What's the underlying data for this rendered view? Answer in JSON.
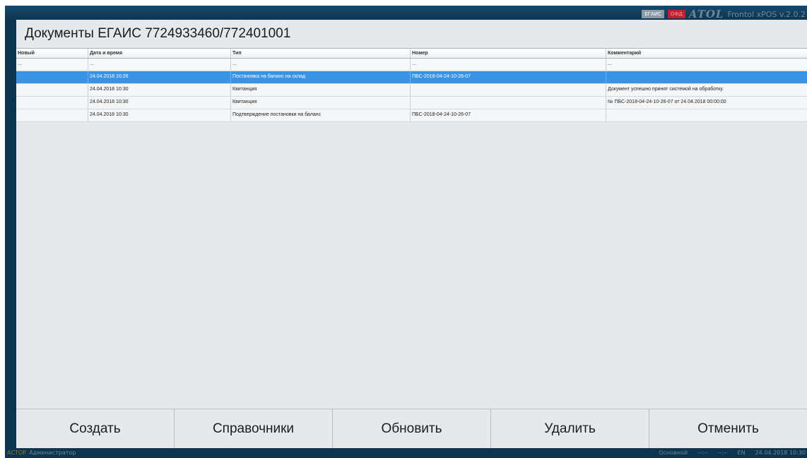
{
  "topbar": {
    "badges": [
      "ЕГАИС",
      "ОФД"
    ],
    "logo": "ATOL",
    "version": "Frontol xPOS v.2.0.2"
  },
  "window": {
    "title": "Документы ЕГАИС 7724933460/772401001"
  },
  "grid": {
    "columns": [
      "Новый",
      "Дата и время",
      "Тип",
      "Номер",
      "Комментарий"
    ],
    "filter_row": [
      "...",
      "...",
      "...",
      "...",
      "..."
    ],
    "rows": [
      [
        "",
        "24.04.2018 10:26",
        "Постановка на баланс на склад",
        "ПБС-2018-04-24-10-26-07",
        ""
      ],
      [
        "",
        "24.04.2018 10:30",
        "Квитанция",
        "",
        "Документ успешно принят системой на обработку."
      ],
      [
        "",
        "24.04.2018 10:30",
        "Квитанция",
        "",
        "№ ПБС-2018-04-24-10-26-07 от 24.04.2018 00:00:00"
      ],
      [
        "",
        "24.04.2018 10:30",
        "Подтверждение постановки на баланс",
        "ПБС-2018-04-24-10-26-07",
        ""
      ]
    ],
    "selected_row": 0
  },
  "actions": {
    "create": "Создать",
    "references": "Справочники",
    "refresh": "Обновить",
    "delete": "Удалить",
    "cancel": "Отменить"
  },
  "statusbar": {
    "app": "АСТОР",
    "user": "Администратор",
    "mode": "Основной",
    "field1": "--:--",
    "field2": "--:--",
    "lang": "EN",
    "datetime": "24.04.2018 10:30"
  }
}
